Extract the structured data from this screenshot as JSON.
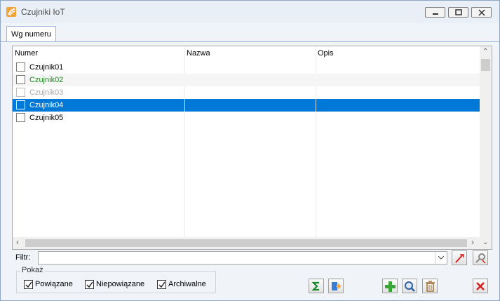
{
  "window": {
    "title": "Czujniki IoT"
  },
  "tabs": [
    {
      "label": "Wg numeru"
    }
  ],
  "grid": {
    "columns": [
      "Numer",
      "Nazwa",
      "Opis"
    ],
    "rows": [
      {
        "numer": "Czujnik01",
        "nazwa": "",
        "opis": "",
        "status": "normal"
      },
      {
        "numer": "Czujnik02",
        "nazwa": "",
        "opis": "",
        "status": "green"
      },
      {
        "numer": "Czujnik03",
        "nazwa": "",
        "opis": "",
        "status": "archived"
      },
      {
        "numer": "Czujnik04",
        "nazwa": "",
        "opis": "",
        "status": "selected"
      },
      {
        "numer": "Czujnik05",
        "nazwa": "",
        "opis": "",
        "status": "normal"
      }
    ]
  },
  "filter": {
    "label": "Filtr:",
    "value": ""
  },
  "show_group": {
    "title": "Pokaż",
    "options": [
      {
        "label": "Powiązane",
        "checked": true
      },
      {
        "label": "Niepowiązane",
        "checked": true
      },
      {
        "label": "Archiwalne",
        "checked": true
      }
    ]
  },
  "colors": {
    "selection": "#0078d7",
    "linked_text": "#1e8a1e",
    "archived_text": "#a8a8a8",
    "add_icon": "#3aa63a",
    "close_icon": "#d62020"
  },
  "icons": [
    "minimize-icon",
    "restore-icon",
    "close-icon",
    "clear-filter-icon",
    "filter-settings-icon",
    "sum-icon",
    "export-icon",
    "add-icon",
    "search-icon",
    "delete-icon",
    "close-window-icon"
  ]
}
